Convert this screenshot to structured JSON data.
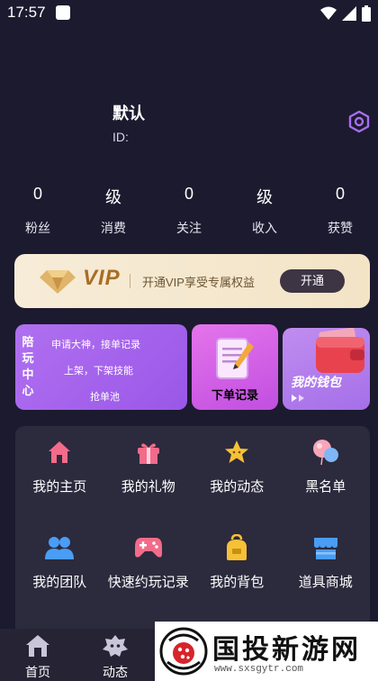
{
  "status": {
    "time": "17:57"
  },
  "profile": {
    "name": "默认",
    "id_label": "ID:"
  },
  "stats": [
    {
      "value": "0",
      "label": "粉丝"
    },
    {
      "value": "级",
      "label": "消费"
    },
    {
      "value": "0",
      "label": "关注"
    },
    {
      "value": "级",
      "label": "收入"
    },
    {
      "value": "0",
      "label": "获赞"
    }
  ],
  "vip": {
    "title": "VIP",
    "description": "开通VIP享受专属权益",
    "button": "开通"
  },
  "cards": {
    "accompany": {
      "vertical_title": [
        "陪",
        "玩",
        "中",
        "心"
      ],
      "line1": "申请大神，接单记录",
      "line2": "上架，下架技能",
      "line3": "抢单池"
    },
    "orders": {
      "label": "下单记录"
    },
    "wallet": {
      "label": "我的钱包"
    }
  },
  "menu": [
    {
      "label": "我的主页",
      "icon": "home-icon",
      "color": "#f36b8a"
    },
    {
      "label": "我的礼物",
      "icon": "gift-icon",
      "color": "#f36b8a"
    },
    {
      "label": "我的动态",
      "icon": "star-icon",
      "color": "#f7c136"
    },
    {
      "label": "黑名单",
      "icon": "balloon-icon",
      "color": "#f36b8a"
    },
    {
      "label": "我的团队",
      "icon": "team-icon",
      "color": "#4a9df5"
    },
    {
      "label": "快速约玩记录",
      "icon": "gamepad-icon",
      "color": "#f36b8a"
    },
    {
      "label": "我的背包",
      "icon": "backpack-icon",
      "color": "#f7c136"
    },
    {
      "label": "道具商城",
      "icon": "store-icon",
      "color": "#4a9df5"
    }
  ],
  "bottom_nav": [
    {
      "label": "首页",
      "icon": "home-nav-icon"
    },
    {
      "label": "动态",
      "icon": "moments-nav-icon"
    }
  ],
  "watermark": {
    "title": "国投新游网",
    "url": "www.sxsgytr.com"
  }
}
